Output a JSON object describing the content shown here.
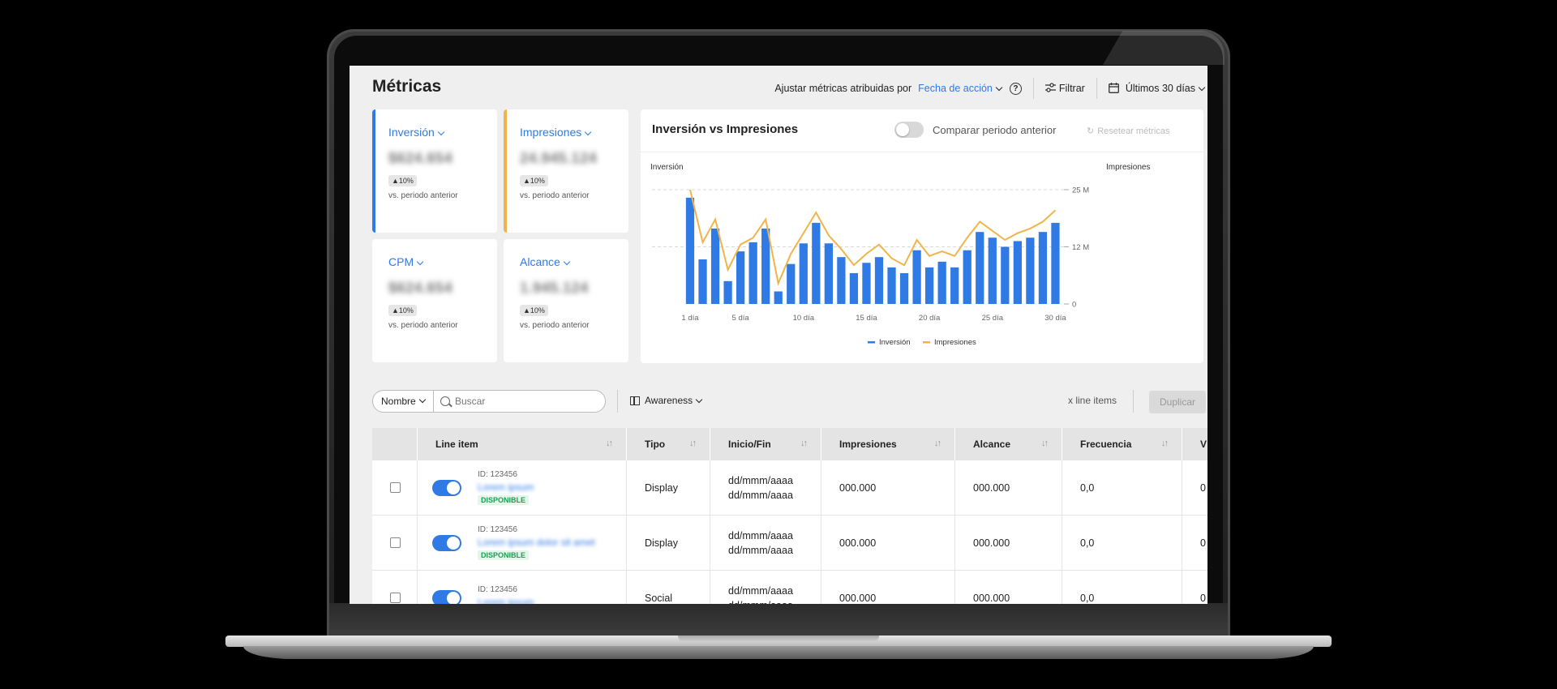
{
  "header": {
    "title": "Métricas",
    "attrib_label": "Ajustar métricas atribuidas por",
    "attrib_value": "Fecha de acción",
    "help": "?",
    "filter_label": "Filtrar",
    "date_range": "Últimos 30 días"
  },
  "kpis": [
    {
      "title": "Inversión",
      "value": "$624.654",
      "change": "▲10%",
      "vs": "vs. periodo anterior",
      "accent": "#2f7ae5"
    },
    {
      "title": "Impresiones",
      "value": "24.945.124",
      "change": "▲10%",
      "vs": "vs. periodo anterior",
      "accent": "#f0b44a"
    },
    {
      "title": "CPM",
      "value": "$624.654",
      "change": "▲10%",
      "vs": "vs. periodo anterior",
      "accent": ""
    },
    {
      "title": "Alcance",
      "value": "1.945.124",
      "change": "▲10%",
      "vs": "vs. periodo anterior",
      "accent": ""
    }
  ],
  "chart_card": {
    "title": "Inversión vs Impresiones",
    "compare_label": "Comparar periodo anterior",
    "reset_label": "Resetear métricas"
  },
  "chart_data": {
    "type": "bar",
    "title": "Inversión vs Impresiones",
    "ylabel": "Inversión",
    "y2label": "Impresiones",
    "x": [
      1,
      2,
      3,
      4,
      5,
      6,
      7,
      8,
      9,
      10,
      11,
      12,
      13,
      14,
      15,
      16,
      17,
      18,
      19,
      20,
      21,
      22,
      23,
      24,
      25,
      26,
      27,
      28,
      29,
      30
    ],
    "xtick_labels": [
      "1 día",
      "5 día",
      "10 día",
      "15 día",
      "20 día",
      "25 día",
      "30 día"
    ],
    "xtick_positions": [
      1,
      5,
      10,
      15,
      20,
      25,
      30
    ],
    "y2ticks": [
      "25 M",
      "12 M",
      "0"
    ],
    "y2tick_values": [
      25,
      12.5,
      0
    ],
    "y2lim": [
      0,
      25
    ],
    "series": [
      {
        "name": "Inversión",
        "type": "bar",
        "color": "#2f7ae5",
        "values": [
          0.93,
          0.39,
          0.66,
          0.2,
          0.46,
          0.54,
          0.66,
          0.11,
          0.35,
          0.53,
          0.71,
          0.53,
          0.41,
          0.27,
          0.36,
          0.41,
          0.32,
          0.27,
          0.47,
          0.32,
          0.37,
          0.32,
          0.47,
          0.63,
          0.58,
          0.5,
          0.55,
          0.58,
          0.63,
          0.71
        ]
      },
      {
        "name": "Impresiones",
        "type": "line",
        "color": "#f0b44a",
        "values": [
          25,
          13.5,
          18.5,
          7.5,
          13,
          14.5,
          18.5,
          4.5,
          11,
          15.5,
          20,
          15,
          12,
          8.5,
          11,
          13,
          10,
          8.5,
          14,
          10.5,
          11.5,
          10.5,
          14.5,
          18,
          16,
          14,
          15.5,
          16.5,
          18,
          20.5
        ]
      }
    ],
    "grid": true,
    "legend": "bottom-center"
  },
  "toolbar": {
    "name_select": "Nombre",
    "search_placeholder": "Buscar",
    "awareness": "Awareness",
    "count": "x line items",
    "duplicate": "Duplicar"
  },
  "table": {
    "columns": [
      "Line item",
      "Tipo",
      "Inicio/Fin",
      "Impresiones",
      "Alcance",
      "Frecuencia",
      "V"
    ],
    "rows": [
      {
        "id": "ID: 123456",
        "name": "Lorem ipsum",
        "status": "DISPONIBLE",
        "type": "Display",
        "start": "dd/mmm/aaaa",
        "end": "dd/mmm/aaaa",
        "impressions": "000.000",
        "reach": "000.000",
        "freq": "0,0",
        "v": "0"
      },
      {
        "id": "ID: 123456",
        "name": "Lorem ipsum dolor sit amet",
        "status": "DISPONIBLE",
        "type": "Display",
        "start": "dd/mmm/aaaa",
        "end": "dd/mmm/aaaa",
        "impressions": "000.000",
        "reach": "000.000",
        "freq": "0,0",
        "v": "0"
      },
      {
        "id": "ID: 123456",
        "name": "Lorem ipsum",
        "status": "",
        "type": "Social",
        "start": "dd/mmm/aaaa",
        "end": "dd/mmm/aaaa",
        "impressions": "000.000",
        "reach": "000.000",
        "freq": "0,0",
        "v": "0"
      }
    ]
  }
}
